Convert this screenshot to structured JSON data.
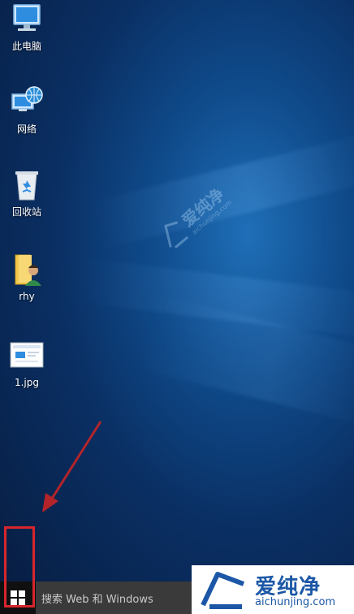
{
  "desktop": {
    "icons": [
      {
        "label": "此电脑",
        "icon": "computer-icon"
      },
      {
        "label": "网络",
        "icon": "network-icon"
      },
      {
        "label": "回收站",
        "icon": "recycle-bin-icon"
      },
      {
        "label": "rhy",
        "icon": "user-folder-icon"
      },
      {
        "label": "1.jpg",
        "icon": "image-file-icon"
      }
    ],
    "watermark": {
      "text": "爱纯净",
      "subtext": "aichunjing.com"
    }
  },
  "taskbar": {
    "start_icon": "windows-logo-icon",
    "search_placeholder": "搜索 Web 和 Windows"
  },
  "brand": {
    "name": "爱纯净",
    "url": "aichunjing.com",
    "color": "#1b57a6"
  },
  "annotation": {
    "arrow_color": "#b3242a",
    "highlight_color": "#d8262c"
  }
}
